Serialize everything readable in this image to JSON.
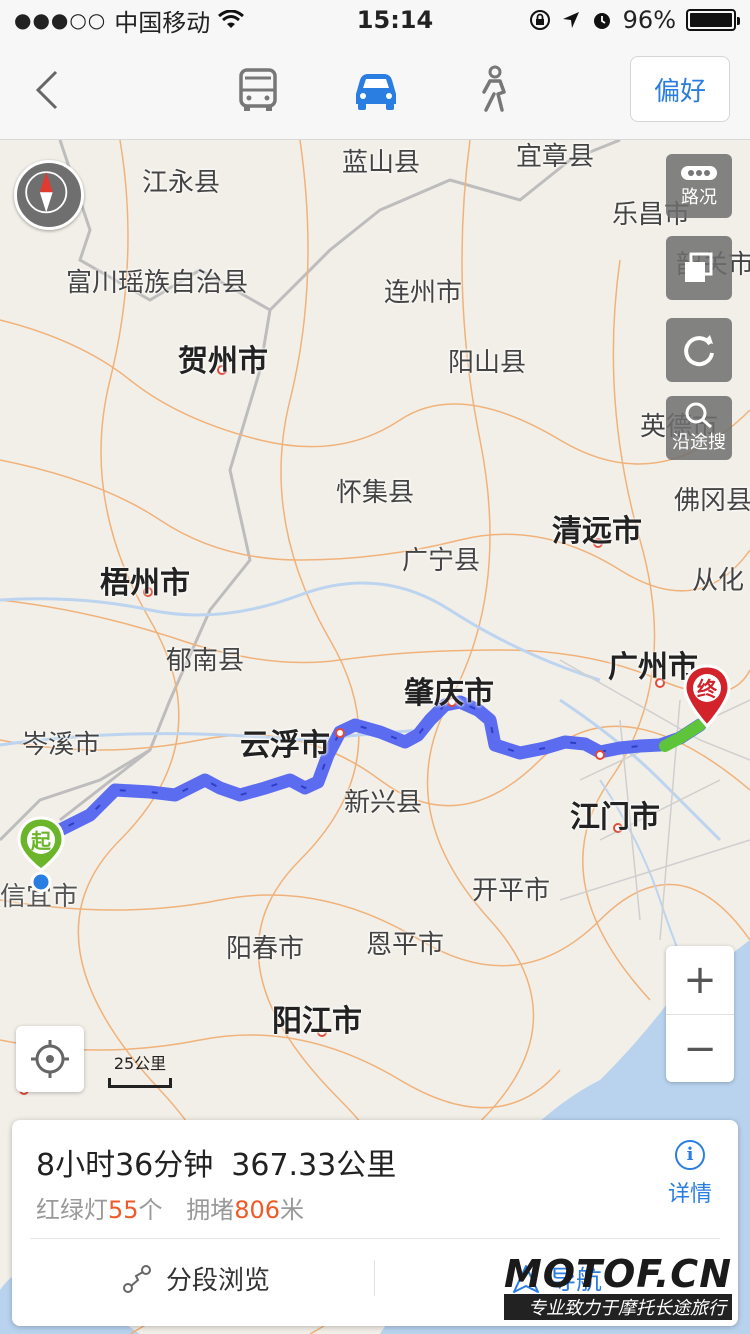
{
  "status_bar": {
    "signal": "●●●○○",
    "carrier": "中国移动",
    "time": "15:14",
    "battery": "96%"
  },
  "nav": {
    "back_icon": "chevron-left-icon",
    "modes": [
      {
        "icon": "bus-icon",
        "active": false
      },
      {
        "icon": "car-icon",
        "active": true
      },
      {
        "icon": "walk-icon",
        "active": false
      }
    ],
    "preference": "偏好"
  },
  "map": {
    "places": [
      {
        "key": "jiangyong",
        "name": "江永县"
      },
      {
        "key": "lanshan",
        "name": "蓝山县"
      },
      {
        "key": "yizhang",
        "name": "宜章县"
      },
      {
        "key": "lechang",
        "name": "乐昌市"
      },
      {
        "key": "fuchuan",
        "name": "富川瑶族自治县"
      },
      {
        "key": "shaoguan",
        "name": "韶关市"
      },
      {
        "key": "lianzhou",
        "name": "连州市"
      },
      {
        "key": "hezhou",
        "name": "贺州市"
      },
      {
        "key": "yangshan",
        "name": "阳山县"
      },
      {
        "key": "yingde",
        "name": "英德市"
      },
      {
        "key": "huaiji",
        "name": "怀集县"
      },
      {
        "key": "fogang",
        "name": "佛冈县"
      },
      {
        "key": "qingyuan",
        "name": "清远市"
      },
      {
        "key": "guangning",
        "name": "广宁县"
      },
      {
        "key": "wuzhou",
        "name": "梧州市"
      },
      {
        "key": "conghua",
        "name": "从化"
      },
      {
        "key": "yunan",
        "name": "郁南县"
      },
      {
        "key": "guangzhou",
        "name": "广州市"
      },
      {
        "key": "zhaoqing",
        "name": "肇庆市"
      },
      {
        "key": "cenxi",
        "name": "岑溪市"
      },
      {
        "key": "yunfu",
        "name": "云浮市"
      },
      {
        "key": "xinxing",
        "name": "新兴县"
      },
      {
        "key": "jiangmen",
        "name": "江门市"
      },
      {
        "key": "xinyi",
        "name": "信宜市"
      },
      {
        "key": "kaiping",
        "name": "开平市"
      },
      {
        "key": "yangchun",
        "name": "阳春市"
      },
      {
        "key": "enping",
        "name": "恩平市"
      },
      {
        "key": "yangjiang",
        "name": "阳江市"
      }
    ],
    "traffic_label": "路况",
    "search_along_label": "沿途搜",
    "scale_label": "25公里",
    "start_marker": "起",
    "end_marker": "终",
    "zoom_in": "+",
    "zoom_out": "−"
  },
  "route": {
    "duration": "8小时36分钟",
    "distance": "367.33公里",
    "lights_label": "红绿灯",
    "lights_count": "55",
    "lights_unit": "个",
    "jam_label": "拥堵",
    "jam_length": "806",
    "jam_unit": "米",
    "details": "详情",
    "segment_browse": "分段浏览",
    "navigate": "导航"
  },
  "watermark": {
    "logo": "MOTOF.CN",
    "slogan": "专业致力于摩托长途旅行"
  },
  "colors": {
    "accent": "#2a7de1",
    "route": "#5b6cf0",
    "highlight": "#f05a28",
    "start_marker": "#6bb52a",
    "end_marker": "#d2222a"
  }
}
